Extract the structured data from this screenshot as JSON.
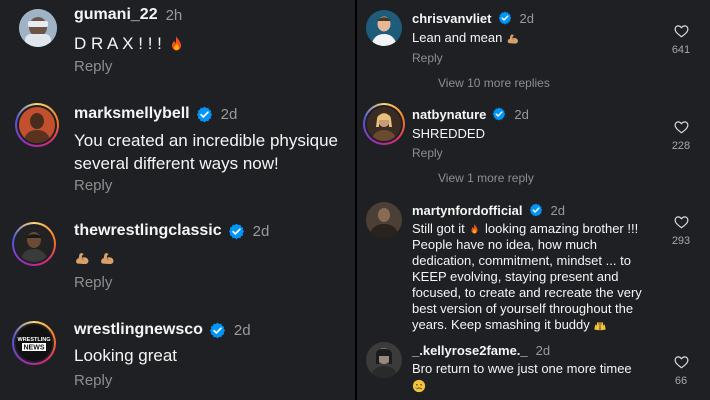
{
  "left": {
    "comments": [
      {
        "username": "gumani_22",
        "time": "2h",
        "text": "D R A X ! ! !",
        "emoji": "fire",
        "reply": "Reply",
        "avatar": "avatar-gumani",
        "verified": false
      },
      {
        "username": "marksmellybell",
        "time": "2d",
        "text_line1": "You created an incredible physique",
        "text_line2": "several different ways now!",
        "reply": "Reply",
        "avatar": "avatar-marksmellybell",
        "verified": true
      },
      {
        "username": "thewrestlingclassic",
        "time": "2d",
        "emoji": "flexed-biceps-x2",
        "reply": "Reply",
        "avatar": "avatar-thewrestlingclassic",
        "verified": true
      },
      {
        "username": "wrestlingnewsco",
        "time": "2d",
        "text": "Looking great",
        "reply": "Reply",
        "avatar": "avatar-wrestlingnewsco",
        "avatar_text_top": "WRESTLING",
        "avatar_text_bottom": "NEWS",
        "verified": true
      }
    ]
  },
  "right": {
    "comments": [
      {
        "username": "chrisvanvliet",
        "time": "2d",
        "text": "Lean and mean",
        "emoji": "flexed-biceps",
        "reply": "Reply",
        "likes": "641",
        "view_more": "View 10 more replies",
        "verified": true
      },
      {
        "username": "natbynature",
        "time": "2d",
        "text": "SHREDDED",
        "reply": "Reply",
        "likes": "228",
        "view_more": "View 1 more reply",
        "verified": true
      },
      {
        "username": "martynfordofficial",
        "time": "2d",
        "text_lines": [
          "Still got it",
          "looking amazing brother !!!",
          "People have no idea, how much",
          "dedication, commitment, mindset ... to",
          "KEEP evolving, staying present and",
          "focused, to create and recreate the very",
          "best version of yourself throughout the",
          "years.  Keep smashing it buddy"
        ],
        "likes": "293",
        "verified": true
      },
      {
        "username": "_.kellyrose2fame._",
        "time": "2d",
        "text": "Bro return to wwe just one more timee",
        "emoji": "sad-face",
        "likes": "66",
        "verified": false
      }
    ]
  },
  "icons": {
    "heart": "heart-outline-icon",
    "verified": "verified-badge-icon",
    "fire": "fire-emoji",
    "biceps": "flexed-biceps-emoji",
    "raising_hands": "raising-hands-emoji",
    "sad": "sad-face-emoji"
  },
  "colors": {
    "background": "#1f2023",
    "verified": "#0095f6",
    "secondary_text": "#8e8e8e"
  }
}
